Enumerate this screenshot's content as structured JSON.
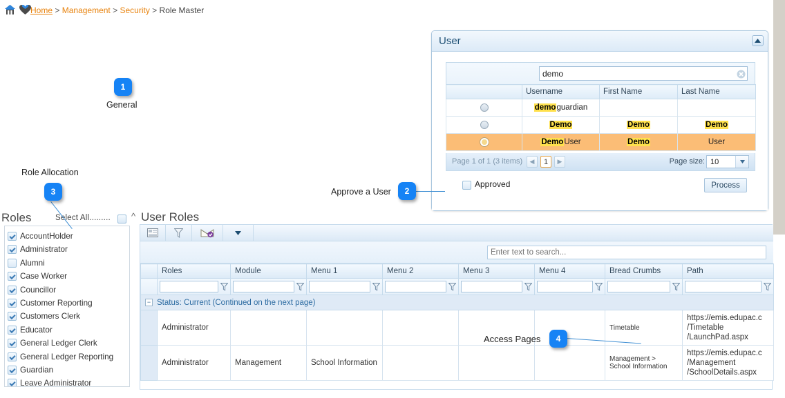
{
  "breadcrumb": {
    "home": "Home",
    "sep": ">",
    "management": "Management",
    "security": "Security",
    "current": "Role Master",
    "home_icon": "home-icon",
    "heart_icon": "favourite-heart-icon"
  },
  "callouts": [
    {
      "number": "1",
      "label": "General"
    },
    {
      "number": "2",
      "label": "Approve a User"
    },
    {
      "number": "3",
      "label": "Role Allocation"
    },
    {
      "number": "4",
      "label": "Access Pages"
    }
  ],
  "user_panel": {
    "title": "User",
    "collapse_icon": "chevron-up-icon",
    "search": {
      "value": "demo",
      "placeholder": "",
      "clear_icon": "clear-circle-icon"
    },
    "columns": [
      "",
      "Username",
      "First Name",
      "Last Name"
    ],
    "rows": [
      {
        "selected": false,
        "radio_icon": "radio-unchecked-icon",
        "username_hl": "demo",
        "username_rest": "guardian",
        "first": "",
        "first_hl": "",
        "last": "",
        "last_hl": ""
      },
      {
        "selected": false,
        "radio_icon": "radio-unchecked-icon",
        "username_hl": "Demo",
        "username_rest": "",
        "first_hl": "Demo",
        "first": "",
        "last_hl": "Demo",
        "last": ""
      },
      {
        "selected": true,
        "radio_icon": "radio-checked-icon",
        "username_hl": "Demo",
        "username_rest": "User",
        "first_hl": "Demo",
        "first": "",
        "last_hl": "",
        "last": "User"
      }
    ],
    "pager": {
      "info": "Page 1 of 1 (3 items)",
      "prev_icon": "chevron-left-icon",
      "next_icon": "chevron-right-icon",
      "current_page": "1",
      "page_size_label": "Page size:",
      "page_size_value": "10",
      "page_size_arrow_icon": "chevron-down-icon"
    },
    "approved": {
      "label": "Approved",
      "checked": false
    },
    "process_button": "Process"
  },
  "roles_panel": {
    "title": "Roles",
    "select_all": "Select All.........",
    "select_all_checked": false,
    "items": [
      {
        "label": "AccountHolder",
        "checked": true
      },
      {
        "label": "Administrator",
        "checked": true
      },
      {
        "label": "Alumni",
        "checked": false
      },
      {
        "label": "Case Worker",
        "checked": true
      },
      {
        "label": "Councillor",
        "checked": true
      },
      {
        "label": "Customer Reporting",
        "checked": true
      },
      {
        "label": "Customers Clerk",
        "checked": true
      },
      {
        "label": "Educator",
        "checked": true
      },
      {
        "label": "General Ledger Clerk",
        "checked": true
      },
      {
        "label": "General Ledger Reporting",
        "checked": true
      },
      {
        "label": "Guardian",
        "checked": true
      },
      {
        "label": "Leave Administrator",
        "checked": true
      }
    ]
  },
  "user_roles_panel": {
    "caret_icon": "chevron-up-icon",
    "title": "User Roles",
    "toolbar": [
      {
        "icon": "card-layout-icon"
      },
      {
        "icon": "filter-funnel-icon"
      },
      {
        "icon": "export-mail-icon"
      },
      {
        "icon": "chevron-down-icon"
      }
    ],
    "search_placeholder": "Enter text to search...",
    "columns": [
      "Roles",
      "Module",
      "Menu 1",
      "Menu 2",
      "Menu 3",
      "Menu 4",
      "Bread Crumbs",
      "Path"
    ],
    "filter_icon": "column-filter-icon",
    "group_row": {
      "expander_icon": "collapse-minus-icon",
      "label": "Status: Current (Continued on the next page)"
    },
    "rows": [
      {
        "roles": "Administrator",
        "module": "",
        "menu1": "",
        "menu2": "",
        "menu3": "",
        "menu4": "",
        "breadcrumbs": "Timetable",
        "path": [
          "https://emis.edupac.c",
          "/Timetable",
          "/LaunchPad.aspx"
        ]
      },
      {
        "roles": "Administrator",
        "module": "Management",
        "menu1": "School Information",
        "menu2": "",
        "menu3": "",
        "menu4": "",
        "breadcrumbs": "Management > School Information",
        "path": [
          "https://emis.edupac.c",
          "/Management",
          "/SchoolDetails.aspx"
        ]
      }
    ]
  },
  "colors": {
    "accent_blue": "#1683f5",
    "breadcrumb_orange": "#e8820c",
    "selected_row": "#fbbd76",
    "highlight_yellow": "#ffe14d",
    "panel_border": "#c6dbec"
  }
}
